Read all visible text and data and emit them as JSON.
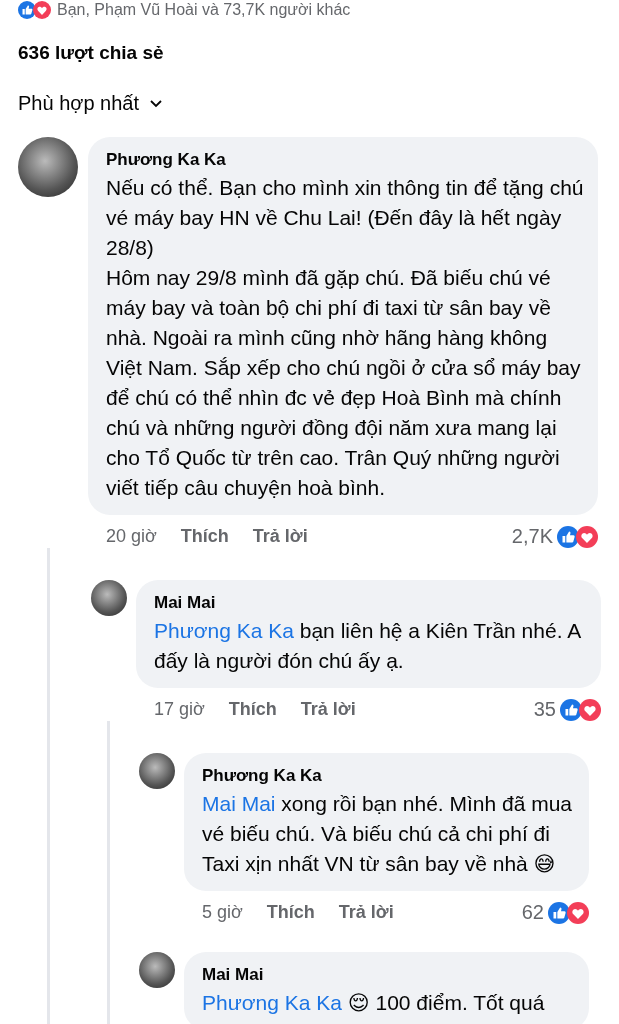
{
  "reactions_summary": {
    "text": "Bạn, Phạm Vũ Hoài và 73,7K người khác"
  },
  "shares": "636 lượt chia sẻ",
  "sort": {
    "label": "Phù hợp nhất"
  },
  "comments": [
    {
      "author": "Phương Ka Ka",
      "text": "Nếu có thể. Bạn cho mình xin thông tin để tặng chú vé máy bay HN về Chu Lai! (Đến đây là hết ngày 28/8)\nHôm nay 29/8 mình đã gặp chú. Đã biếu chú vé máy bay và toàn bộ chi phí đi taxi từ sân bay về nhà. Ngoài ra mình cũng nhờ hãng hàng không Việt Nam. Sắp xếp cho chú ngồi ở cửa sổ máy bay để chú có thể nhìn đc vẻ đẹp Hoà Bình mà chính chú và những người đồng đội năm xưa mang lại cho Tổ Quốc từ trên cao. Trân Quý những người viết tiếp câu chuyện hoà bình.",
      "time": "20 giờ",
      "like": "Thích",
      "reply": "Trả lời",
      "count": "2,7K",
      "children": [
        {
          "author": "Mai Mai",
          "mention": "Phương Ka Ka",
          "text": "bạn liên hệ a Kiên Trần nhé. A đấy là người đón chú ấy ạ.",
          "time": "17 giờ",
          "like": "Thích",
          "reply": "Trả lời",
          "count": "35",
          "children": [
            {
              "author": "Phương Ka Ka",
              "mention": "Mai Mai",
              "text": "xong rồi bạn nhé. Mình đã mua vé biếu chú. Và biếu chú cả chi phí đi Taxi xịn nhất VN từ sân bay về nhà 😅",
              "time": "5 giờ",
              "like": "Thích",
              "reply": "Trả lời",
              "count": "62"
            },
            {
              "author": "Mai Mai",
              "mention": "Phương Ka Ka",
              "text": "😌 100 điểm. Tốt quá"
            }
          ]
        }
      ]
    }
  ]
}
